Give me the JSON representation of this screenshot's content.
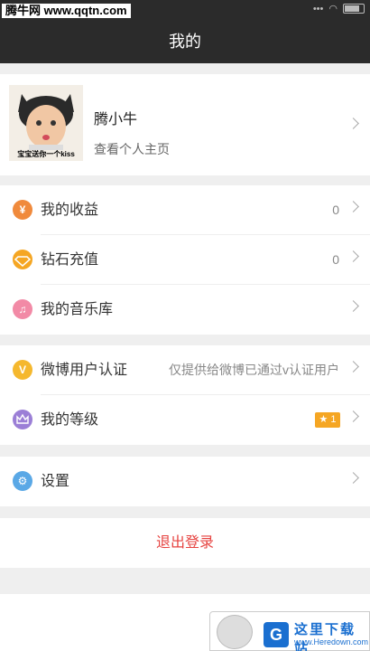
{
  "watermark_top": "腾牛网 www.qqtn.com",
  "navbar": {
    "title": "我的"
  },
  "profile": {
    "name": "腾小牛",
    "subtitle": "查看个人主页",
    "avatar_caption": "宝宝送你一个kiss"
  },
  "menu": {
    "earnings": {
      "label": "我的收益",
      "value": "0",
      "icon": "yen-icon",
      "color": "#f08a3c"
    },
    "diamond": {
      "label": "钻石充值",
      "value": "0",
      "icon": "diamond-icon",
      "color": "#f5a623"
    },
    "music": {
      "label": "我的音乐库",
      "icon": "music-note-icon",
      "color": "#f28aa6"
    },
    "weibo_verify": {
      "label": "微博用户认证",
      "value": "仅提供给微博已通过v认证用户",
      "icon": "v-badge-icon",
      "icon_text": "V",
      "color": "#f5b82e"
    },
    "level": {
      "label": "我的等级",
      "badge": "1",
      "icon": "crown-icon",
      "color": "#9b7fd6"
    },
    "settings": {
      "label": "设置",
      "icon": "gear-icon",
      "color": "#5aa8e6"
    }
  },
  "logout_label": "退出登录",
  "watermark_bottom": {
    "title": "这里下载站",
    "url": "www.Heredown.com"
  }
}
